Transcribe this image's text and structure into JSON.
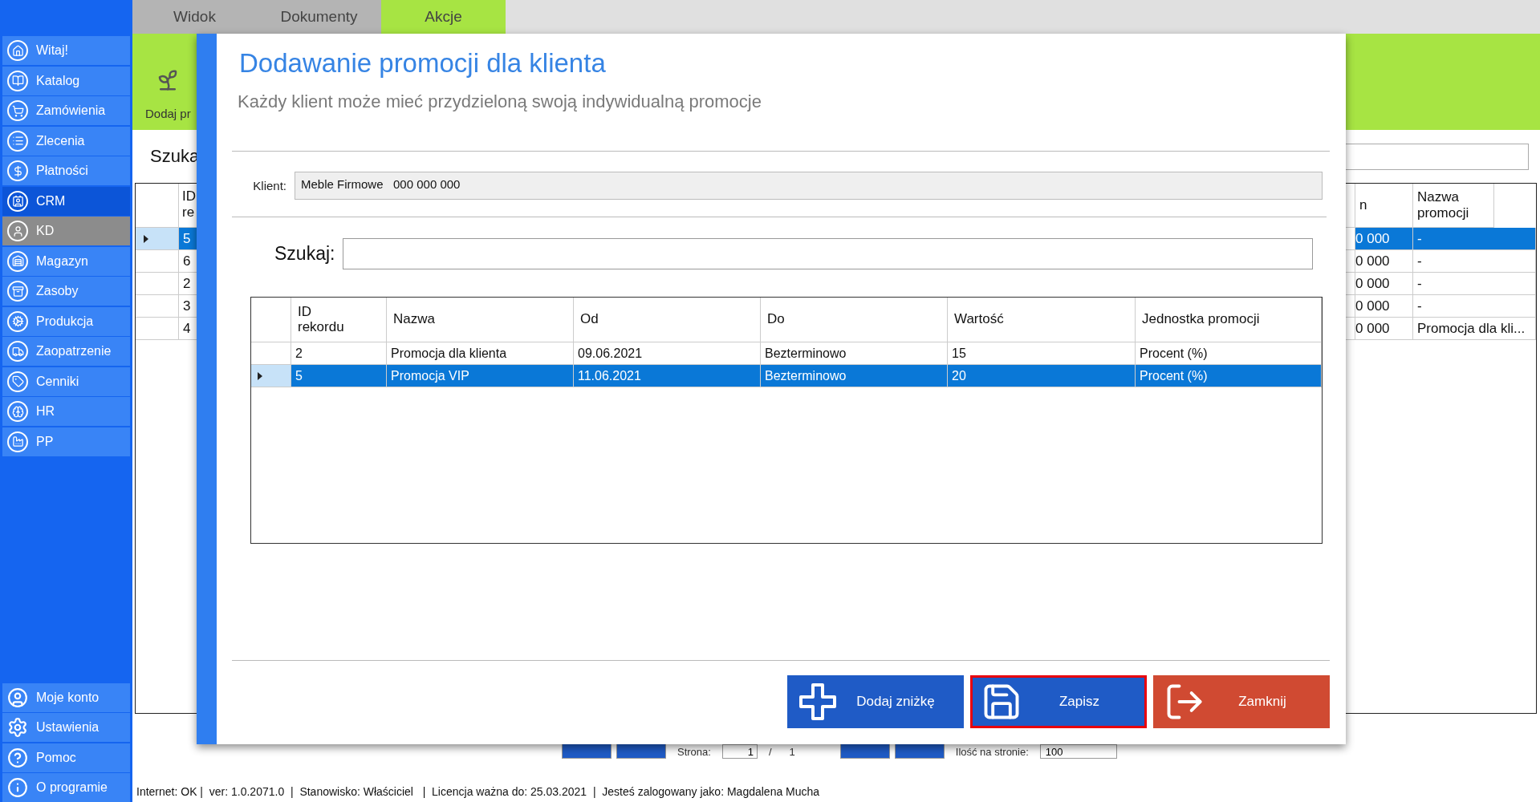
{
  "sidebar": {
    "items": [
      {
        "label": "Witaj!",
        "selected": false,
        "open": false
      },
      {
        "label": "Katalog",
        "selected": false,
        "open": false
      },
      {
        "label": "Zamówienia",
        "selected": false,
        "open": false
      },
      {
        "label": "Zlecenia",
        "selected": false,
        "open": false
      },
      {
        "label": "Płatności",
        "selected": false,
        "open": false
      },
      {
        "label": "CRM",
        "selected": false,
        "open": true
      },
      {
        "label": "KD",
        "selected": true,
        "open": false
      },
      {
        "label": "Magazyn",
        "selected": false,
        "open": false
      },
      {
        "label": "Zasoby",
        "selected": false,
        "open": false
      },
      {
        "label": "Produkcja",
        "selected": false,
        "open": false
      },
      {
        "label": "Zaopatrzenie",
        "selected": false,
        "open": false
      },
      {
        "label": "Cenniki",
        "selected": false,
        "open": false
      },
      {
        "label": "HR",
        "selected": false,
        "open": false
      },
      {
        "label": "PP",
        "selected": false,
        "open": false
      }
    ],
    "bottom_items": [
      {
        "label": "Moje konto"
      },
      {
        "label": "Ustawienia"
      },
      {
        "label": "Pomoc"
      },
      {
        "label": "O programie"
      }
    ]
  },
  "tabs": [
    {
      "label": "Widok",
      "selected": false
    },
    {
      "label": "Dokumenty",
      "selected": false
    },
    {
      "label": "Akcje",
      "selected": true
    }
  ],
  "ribbon": {
    "button_label": "Dodaj pr"
  },
  "search": {
    "label": "Szuka"
  },
  "table": {
    "left_header": "ID re",
    "right_columns": [
      "n",
      "Nazwa promocji"
    ],
    "rows": [
      {
        "id": "5",
        "column_2": "0 000",
        "promotion": "-",
        "selected": true
      },
      {
        "id": "6",
        "column_2": "0 000",
        "promotion": "-",
        "selected": false
      },
      {
        "id": "2",
        "column_2": "0 000",
        "promotion": "-",
        "selected": false
      },
      {
        "id": "3",
        "column_2": "0 000",
        "promotion": "-",
        "selected": false
      },
      {
        "id": "4",
        "column_2": "0 000",
        "promotion": "Promocja dla kli...",
        "selected": false
      }
    ]
  },
  "pager": {
    "page_label": "Strona:",
    "page": "1",
    "separator": "/",
    "pages": "1",
    "per_page_label": "Ilość na stronie:",
    "per_page": "100"
  },
  "status_bar": "Internet: OK |  ver: 1.0.2071.0  |  Stanowisko: Właściciel   |  Licencja ważna do: 25.03.2021  |  Jesteś zalogowany jako: Magdalena Mucha",
  "dialog": {
    "title": "Dodawanie promocji dla klienta",
    "subtitle": "Każdy klient może mieć przydzieloną swoją indywidualną promocje",
    "client_label": "Klient:",
    "client_value": "Meble Firmowe   000 000 000",
    "search_label": "Szukaj:",
    "table": {
      "columns": [
        "ID rekordu",
        "Nazwa",
        "Od",
        "Do",
        "Wartość",
        "Jednostka promocji"
      ],
      "rows": [
        {
          "cells": [
            "2",
            "Promocja dla klienta",
            "09.06.2021",
            "Bezterminowo",
            "15",
            "Procent (%)"
          ],
          "selected": false
        },
        {
          "cells": [
            "5",
            "Promocja VIP",
            "11.06.2021",
            "Bezterminowo",
            "20",
            "Procent (%)"
          ],
          "selected": true
        }
      ]
    },
    "buttons": [
      {
        "label": "Dodaj zniżkę",
        "kind": "add",
        "focused": false
      },
      {
        "label": "Zapisz",
        "kind": "save",
        "focused": true
      },
      {
        "label": "Zamknij",
        "kind": "close",
        "focused": false
      }
    ]
  }
}
